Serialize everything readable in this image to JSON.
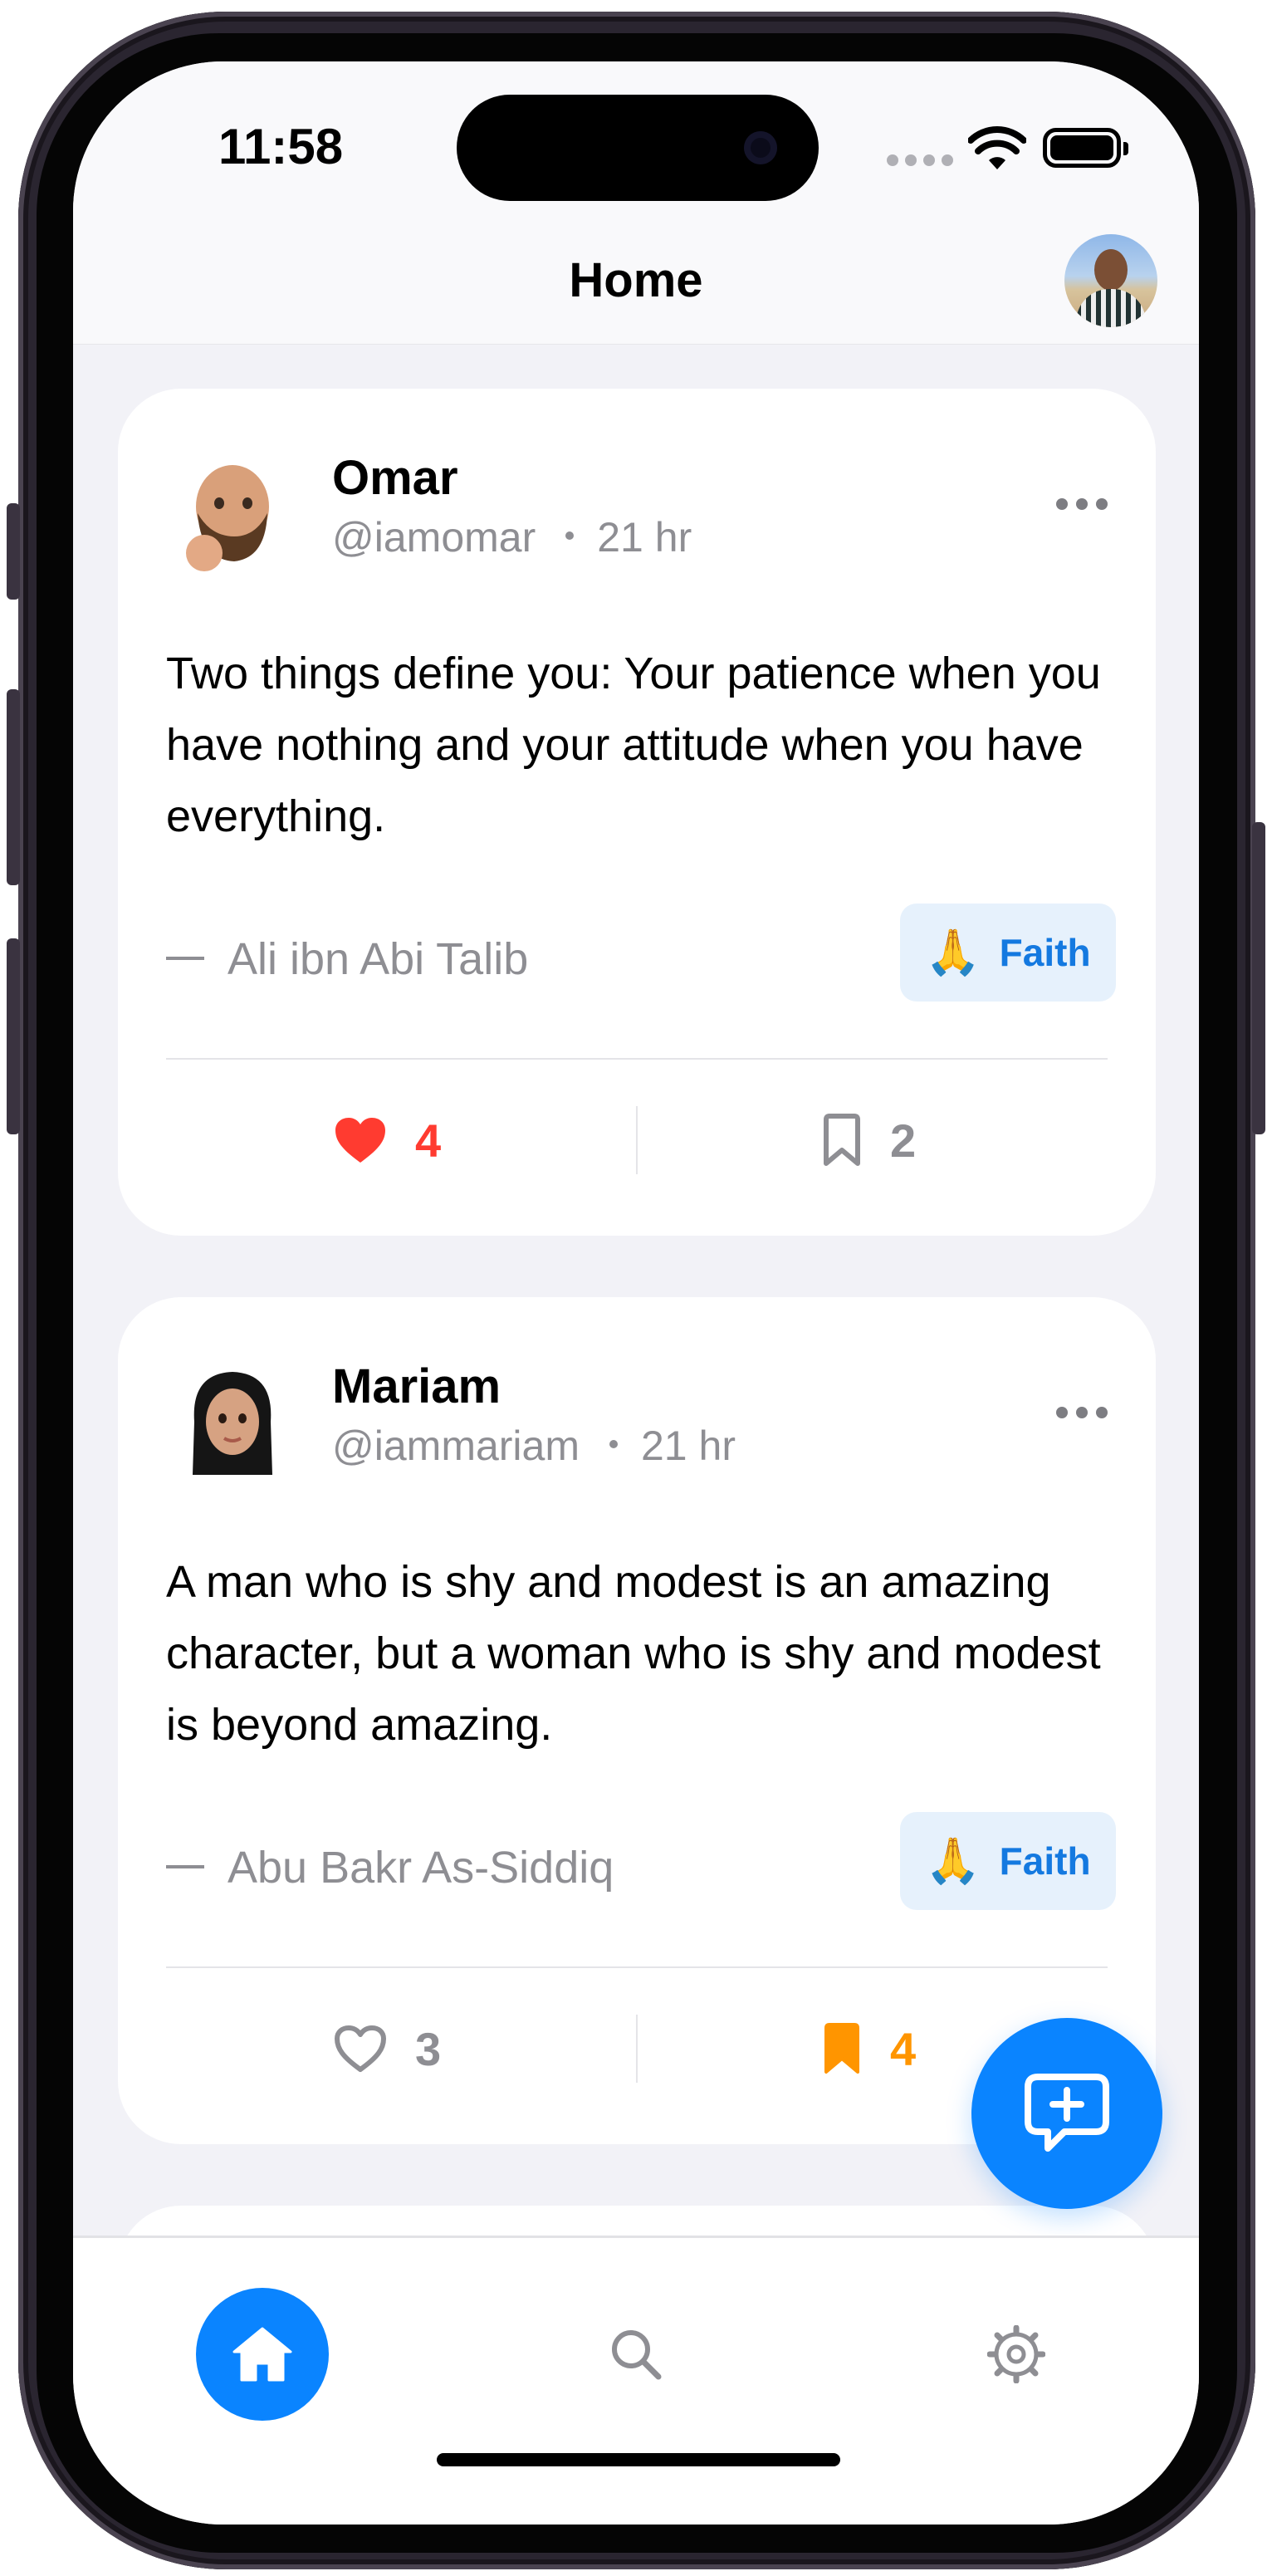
{
  "status_bar": {
    "time": "11:58"
  },
  "navbar": {
    "title": "Home"
  },
  "posts": [
    {
      "name": "Omar",
      "handle": "@iamomar",
      "time": "21 hr",
      "quote": "Two things define you: Your patience when you have nothing and your attitude when you have everything.",
      "author": "Ali ibn Abi Talib",
      "tag": {
        "emoji": "🙏",
        "label": "Faith"
      },
      "likes": "4",
      "saves": "2",
      "liked": true,
      "saved": false
    },
    {
      "name": "Mariam",
      "handle": "@iammariam",
      "time": "21 hr",
      "quote": "A man who is shy and modest is an amazing character, but a woman who is shy and modest is beyond amazing.",
      "author": "Abu Bakr As-Siddiq",
      "tag": {
        "emoji": "🙏",
        "label": "Faith"
      },
      "likes": "3",
      "saves": "4",
      "liked": false,
      "saved": true
    }
  ],
  "tabbar": {
    "active": "home",
    "items": [
      "home-icon",
      "search-icon",
      "gear-icon"
    ]
  },
  "colors": {
    "accent": "#0a84ff",
    "like": "#ff3b30",
    "bookmark": "#ff9500",
    "tag_bg": "#e6f1fc",
    "tag_text": "#1479e0"
  }
}
